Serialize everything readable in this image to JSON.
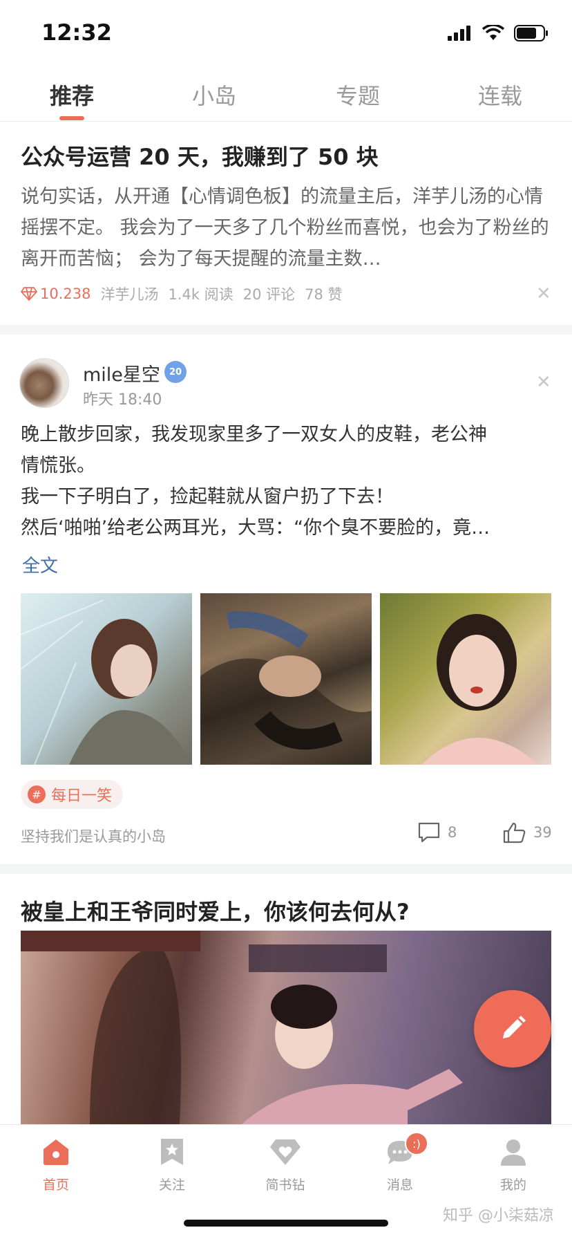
{
  "status": {
    "time": "12:32"
  },
  "tabs": [
    {
      "label": "推荐",
      "active": true
    },
    {
      "label": "小岛",
      "active": false
    },
    {
      "label": "专题",
      "active": false
    },
    {
      "label": "连载",
      "active": false
    }
  ],
  "article1": {
    "title": "公众号运营 20 天，我赚到了 50 块",
    "body": "说句实话，从开通【心情调色板】的流量主后，洋芋儿汤的心情摇摆不定。 我会为了一天多了几个粉丝而喜悦，也会为了粉丝的离开而苦恼； 会为了每天提醒的流量主数…",
    "diamond": "10.238",
    "author": "洋芋儿汤",
    "reads": "1.4k 阅读",
    "comments": "20 评论",
    "likes": "78 赞"
  },
  "post2": {
    "username": "mile星空",
    "badge": "20",
    "time": "昨天 18:40",
    "lines": [
      "晚上散步回家，我发现家里多了一双女人的皮鞋，老公神",
      "情慌张。",
      "我一下子明白了，捡起鞋就从窗户扔了下去！",
      "然后‘啪啪’给老公两耳光，大骂：“你个臭不要脸的，竟…"
    ],
    "fulltext_label": "全文",
    "tag": "每日一笑",
    "island": "坚持我们是认真的小岛",
    "comment_count": "8",
    "like_count": "39"
  },
  "article3": {
    "title": "被皇上和王爷同时爱上，你该何去何从?"
  },
  "nav": [
    {
      "label": "首页",
      "icon": "home-icon",
      "active": true
    },
    {
      "label": "关注",
      "icon": "bookmark-star-icon",
      "active": false
    },
    {
      "label": "简书钻",
      "icon": "diamond-heart-icon",
      "active": false
    },
    {
      "label": "消息",
      "icon": "chat-bubble-icon",
      "active": false,
      "badge": ":)"
    },
    {
      "label": "我的",
      "icon": "person-icon",
      "active": false
    }
  ],
  "watermark": "知乎 @小柒菇凉",
  "colors": {
    "accent": "#ea6f5a",
    "link": "#3f6ea8"
  }
}
